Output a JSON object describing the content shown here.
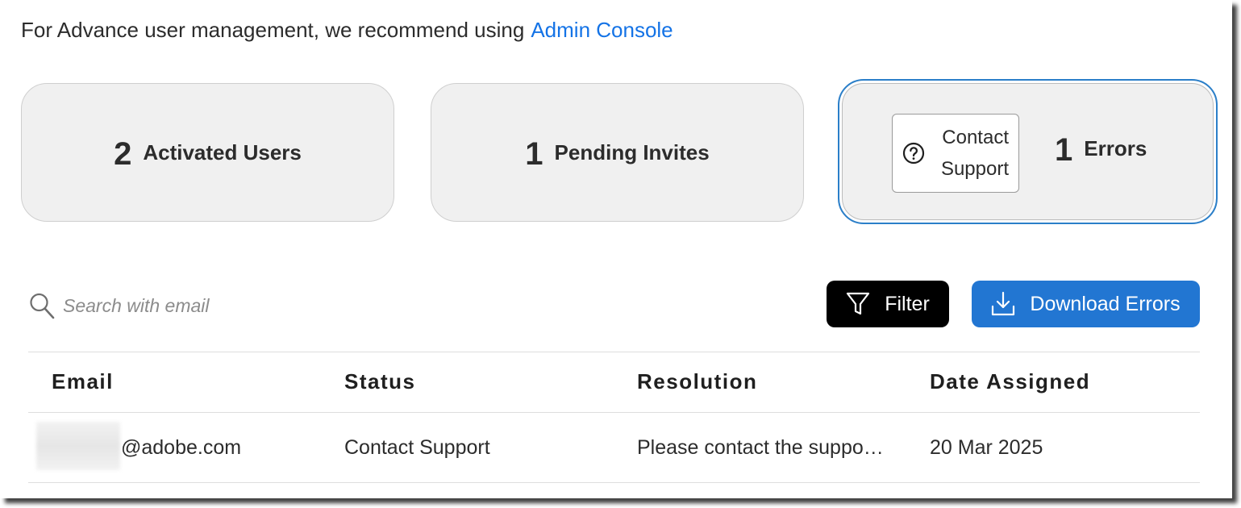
{
  "intro": {
    "text": "For Advance user management, we recommend using",
    "link": "Admin Console"
  },
  "cards": {
    "activated": {
      "count": "2",
      "label": "Activated Users"
    },
    "pending": {
      "count": "1",
      "label": "Pending Invites"
    },
    "errors": {
      "count": "1",
      "label": "Errors",
      "support_line1": "Contact",
      "support_line2": "Support"
    }
  },
  "toolbar": {
    "search_placeholder": "Search with email",
    "filter_label": "Filter",
    "download_label": "Download Errors"
  },
  "table": {
    "headers": [
      "Email",
      "Status",
      "Resolution",
      "Date Assigned"
    ],
    "rows": [
      {
        "email": "@adobe.com",
        "status": "Contact Support",
        "resolution": "Please contact the suppo…",
        "date": "20 Mar 2025"
      }
    ]
  },
  "colors": {
    "link": "#1473e6",
    "selected_border": "#2b7fc9",
    "download_button": "#2276d2",
    "filter_button": "#000000",
    "card_background": "#f0f0f0"
  },
  "icons": [
    "help-circle-icon",
    "search-icon",
    "filter-icon",
    "download-icon"
  ]
}
